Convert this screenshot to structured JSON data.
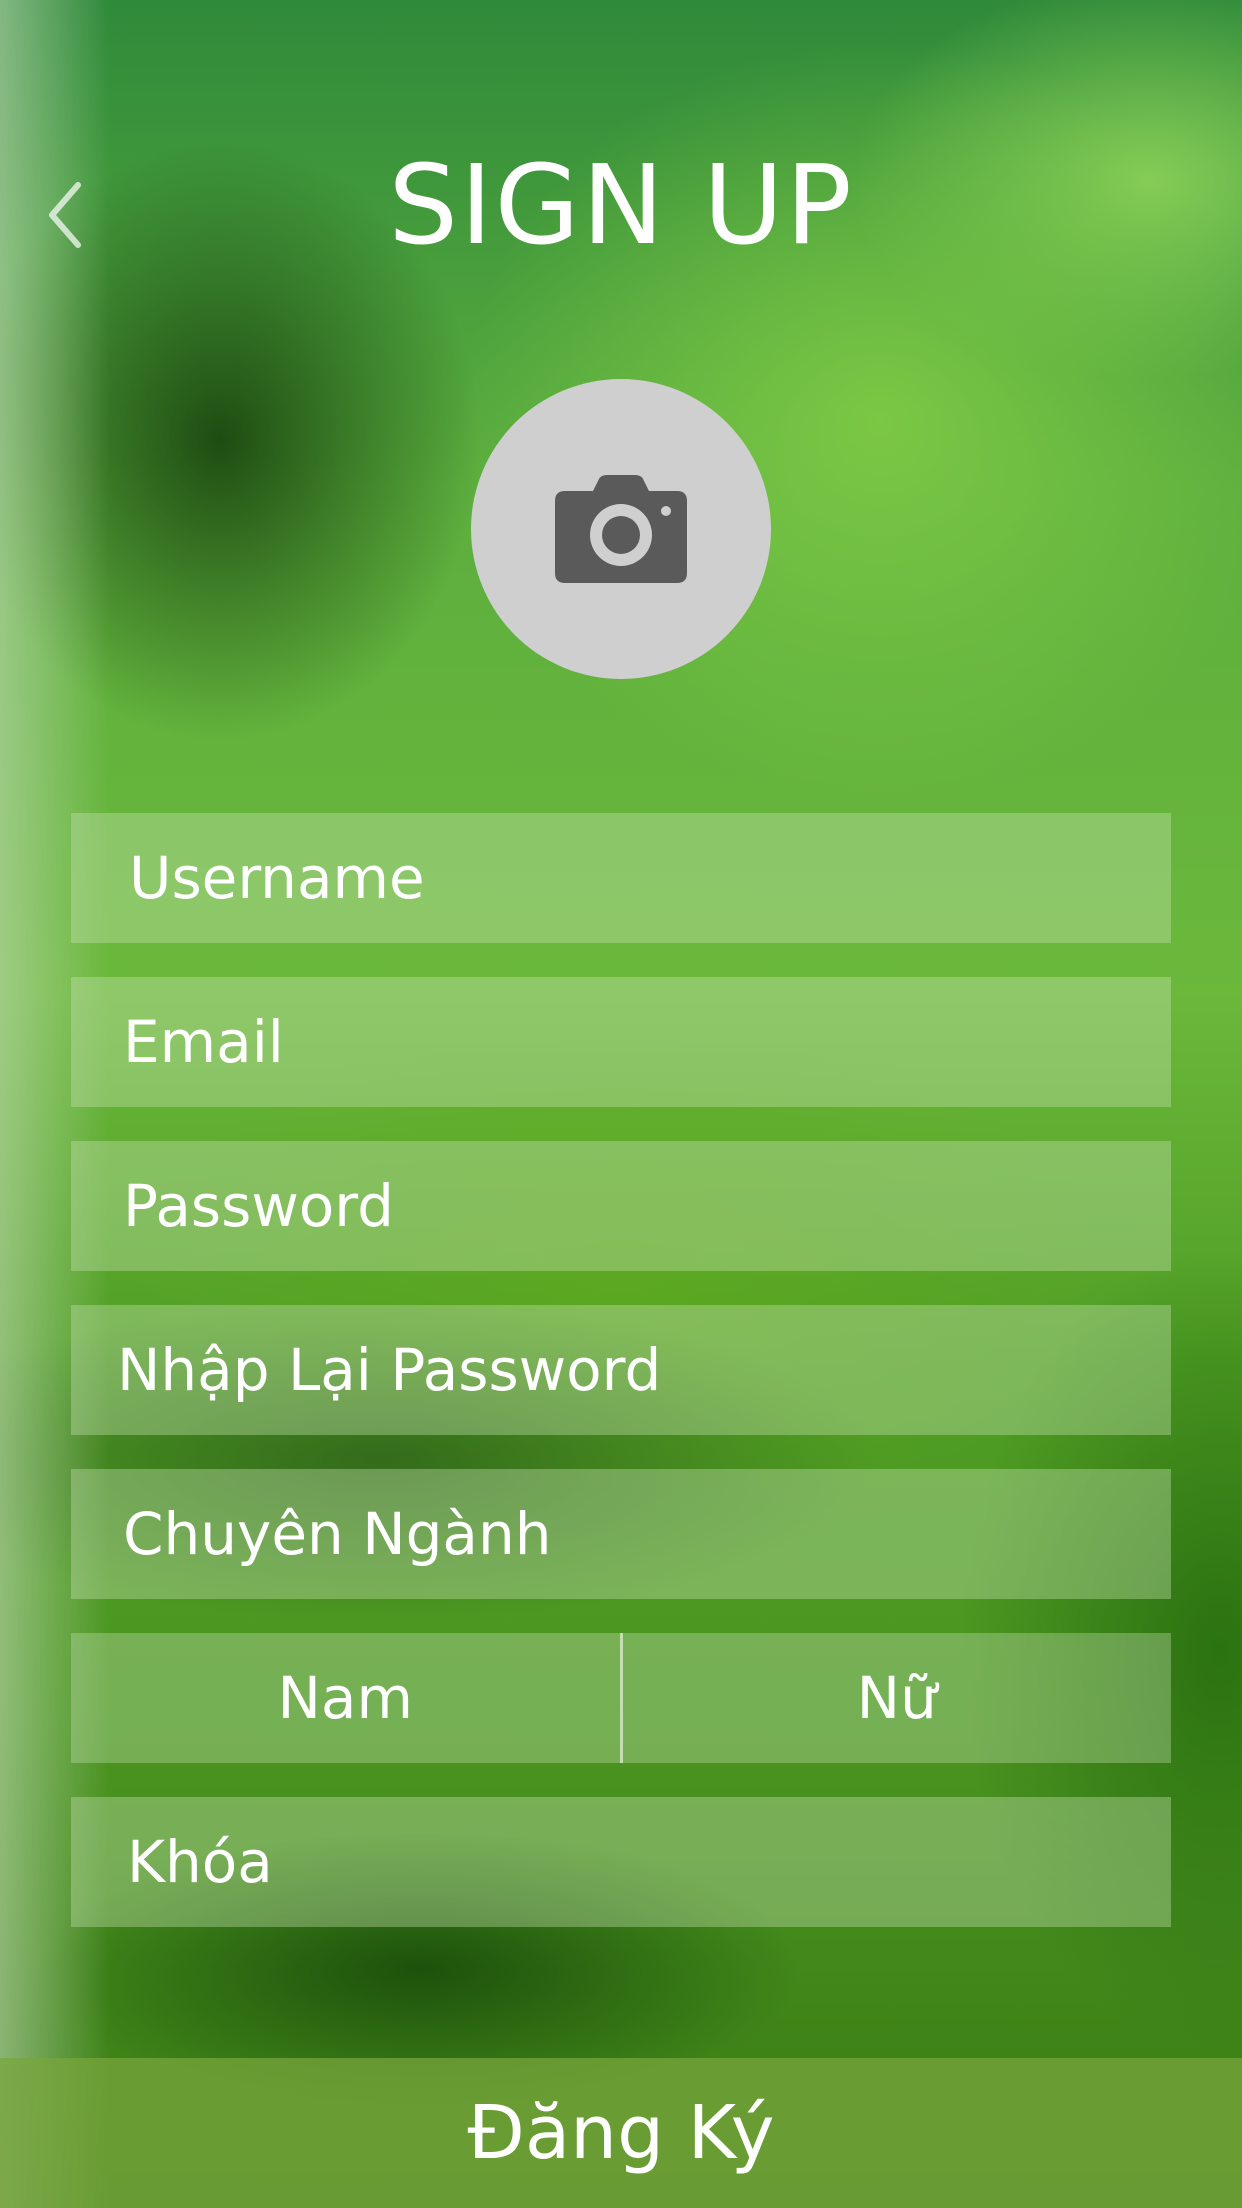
{
  "header": {
    "title": "SIGN UP"
  },
  "form": {
    "username_placeholder": "Username",
    "email_placeholder": "Email",
    "password_placeholder": "Password",
    "confirm_password_placeholder": "Nhập Lại Password",
    "major_placeholder": "Chuyên Ngành",
    "gender": {
      "male_label": "Nam",
      "female_label": "Nữ"
    },
    "course_placeholder": "Khóa"
  },
  "submit": {
    "label": "Đăng Ký"
  },
  "icons": {
    "back": "chevron-left-icon",
    "avatar": "camera-icon"
  },
  "colors": {
    "avatar_bg": "#cfcfcf",
    "camera_icon": "#5a5a5a",
    "text": "#ffffff"
  }
}
